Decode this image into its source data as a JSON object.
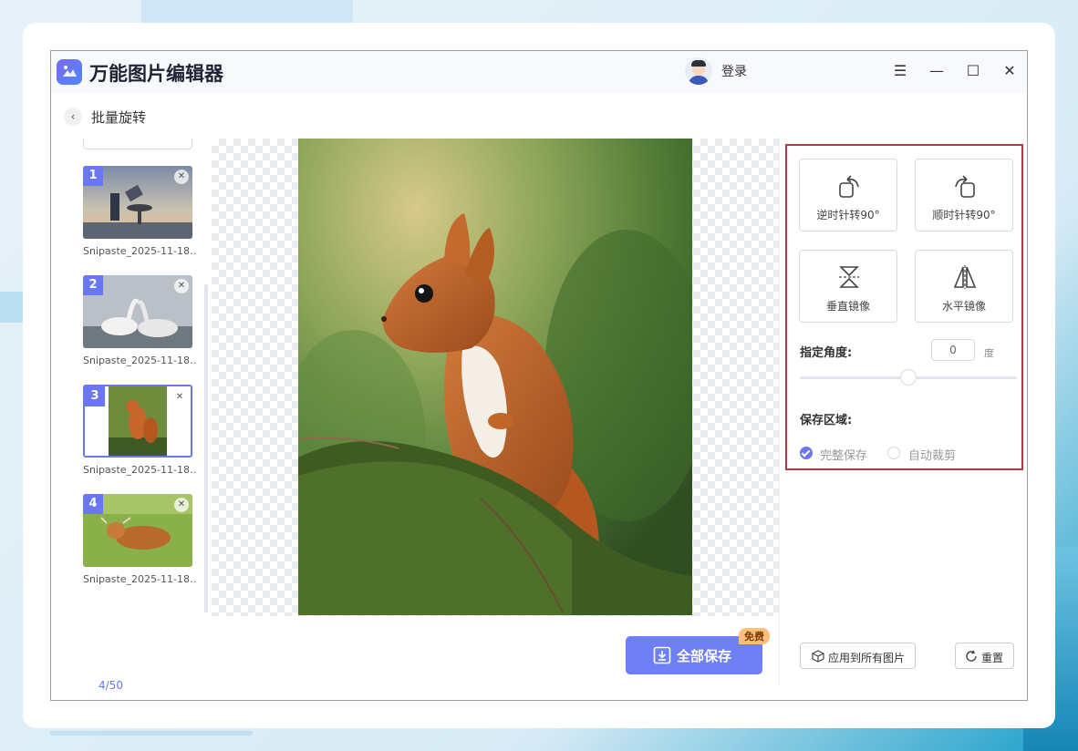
{
  "app": {
    "title": "万能图片编辑器",
    "login_label": "登录"
  },
  "window_controls": {
    "menu": "☰",
    "minimize": "—",
    "maximize": "☐",
    "close": "✕"
  },
  "page": {
    "back_icon": "‹",
    "title": "批量旋转"
  },
  "thumbnails": [
    {
      "number": "1",
      "filename": "Snipaste_2025-11-18...",
      "selected": false
    },
    {
      "number": "2",
      "filename": "Snipaste_2025-11-18...",
      "selected": false
    },
    {
      "number": "3",
      "filename": "Snipaste_2025-11-18...",
      "selected": true
    },
    {
      "number": "4",
      "filename": "Snipaste_2025-11-18...",
      "selected": false
    }
  ],
  "counter": "4/50",
  "tools": {
    "rotate_ccw": "逆时针转90°",
    "rotate_cw": "顺时针转90°",
    "flip_vertical": "垂直镜像",
    "flip_horizontal": "水平镜像"
  },
  "angle": {
    "label": "指定角度:",
    "value": "0",
    "unit": "度"
  },
  "save_region": {
    "label": "保存区域:",
    "options": [
      {
        "label": "完整保存",
        "checked": true
      },
      {
        "label": "自动裁剪",
        "checked": false
      }
    ]
  },
  "actions": {
    "save_all": "全部保存",
    "free_badge": "免费",
    "apply_all": "应用到所有图片",
    "reset": "重置"
  },
  "colors": {
    "accent": "#6a77f0",
    "save_button": "#6f7ff5",
    "panel_border": "#b23a48",
    "badge": "#ffbe7a"
  }
}
